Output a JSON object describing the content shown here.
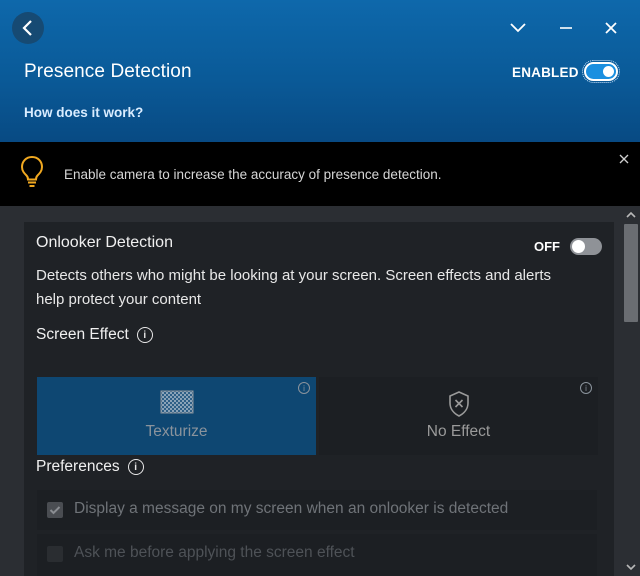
{
  "header": {
    "title": "Presence Detection",
    "status_label": "ENABLED",
    "status_on": true,
    "help_link": "How does it work?",
    "back_icon": "chevron-left-icon",
    "minimize_icon": "chevron-down-icon",
    "restore_icon": "minus-icon",
    "close_icon": "close-icon"
  },
  "banner": {
    "icon": "lightbulb-icon",
    "message": "Enable camera to increase the accuracy of presence detection.",
    "accent_color": "#f0a820"
  },
  "onlooker": {
    "title": "Onlooker Detection",
    "toggle_label": "OFF",
    "toggle_on": false,
    "description": "Detects others who might be looking at your screen. Screen effects and alerts help protect your content",
    "screen_effect_label": "Screen Effect",
    "effects": [
      {
        "label": "Texturize",
        "icon": "checkerboard-icon",
        "selected": true
      },
      {
        "label": "No Effect",
        "icon": "shield-x-icon",
        "selected": false
      }
    ],
    "preferences_label": "Preferences",
    "preferences": [
      {
        "label": "Display a message on my screen when an onlooker is detected",
        "checked": true
      },
      {
        "label": "Ask me before applying the screen effect",
        "checked": false
      }
    ]
  },
  "colors": {
    "header_blue": "#0a5a98",
    "selected_tile": "#0e4772",
    "background": "#2b2e33",
    "card": "#1f2226"
  }
}
